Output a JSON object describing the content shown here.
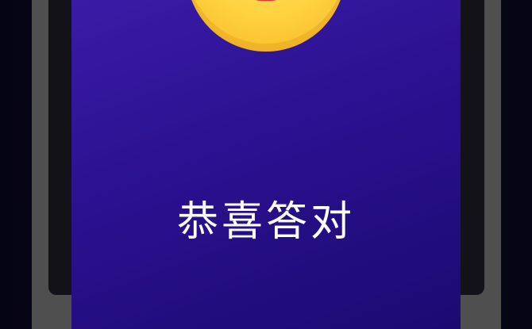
{
  "dialog": {
    "message": "恭喜答对",
    "emoji_icon": "laughing-face-icon"
  },
  "colors": {
    "panel_top": "#3a1ba6",
    "panel_bottom": "#1c0a72",
    "frame": "#4f4f4f",
    "inner_card": "#121218",
    "emoji_yellow": "#ffd23f",
    "text": "#ffffff"
  }
}
